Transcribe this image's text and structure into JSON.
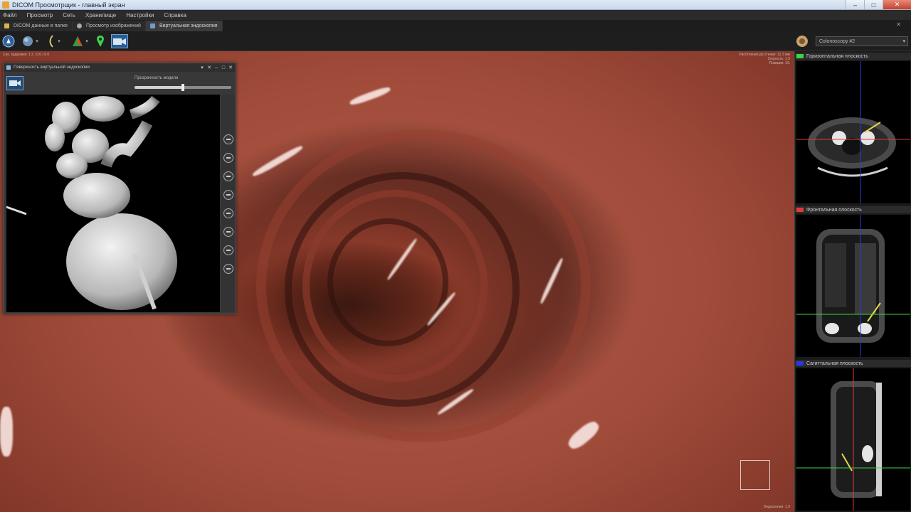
{
  "window": {
    "title": "DICOM Просмотрщик - главный экран",
    "controls": [
      "–",
      "□",
      "✕"
    ]
  },
  "menu": [
    "Файл",
    "Просмотр",
    "Сеть",
    "Хранилище",
    "Настройки",
    "Справка"
  ],
  "tabs": [
    {
      "label": "DICOM данные в папке",
      "icon": "folder-icon",
      "active": false
    },
    {
      "label": "Просмотр изображений",
      "icon": "viewer-icon",
      "active": false
    },
    {
      "label": "Виртуальная эндоскопия",
      "icon": "endoscopy-icon",
      "active": true
    }
  ],
  "tabbar_close": "✕",
  "toolbar": {
    "tools": [
      {
        "name": "navigation-tool",
        "icon": "compass-icon"
      },
      {
        "name": "rotate-tool",
        "icon": "rotate-icon"
      },
      {
        "name": "curve-tool",
        "icon": "curve-icon"
      },
      {
        "name": "segmentation-tool",
        "icon": "segmentation-icon"
      },
      {
        "name": "marker-tool",
        "icon": "map-pin-icon"
      },
      {
        "name": "video-tool",
        "icon": "video-camera-icon"
      }
    ],
    "mode_select": "Colonoscopy #2",
    "colors": {
      "accent": "#3a7bd5",
      "pin": "#3ad44a",
      "curve": "#d8c06a"
    }
  },
  "main_view": {
    "top_left_text": "Сек. задержки: 1.2 ; 0.0 / 0.0",
    "top_right_lines": [
      "Расстояние до стенки: 12.3 мм",
      "Скорость: 1.0",
      "Позиция: 1/1"
    ],
    "bottom_right_text": "Эндоскопия: 1.0",
    "colors": {
      "mucosa": "#b05a47",
      "lumen": "#3a1812"
    }
  },
  "panel": {
    "title": "Поверхность виртуальной эндоскопии",
    "controls": [
      "▾",
      "✕",
      "–",
      "□",
      "✕"
    ],
    "opacity_label": "Прозрачность модели",
    "opacity_value": 0.5,
    "side_buttons": [
      "zoom-in-icon",
      "zoom-out-icon",
      "fit-icon",
      "reset-icon",
      "front-view-icon",
      "side-view-icon",
      "top-view-icon",
      "center-icon"
    ]
  },
  "right_column": {
    "views": [
      {
        "label": "Горизонтальная плоскость",
        "color": "#3ad44a",
        "plane": "axial"
      },
      {
        "label": "Фронтальная плоскость",
        "color": "#e23a3a",
        "plane": "coronal"
      },
      {
        "label": "Сагиттальная плоскость",
        "color": "#2a3ae2",
        "plane": "sagittal"
      }
    ]
  }
}
